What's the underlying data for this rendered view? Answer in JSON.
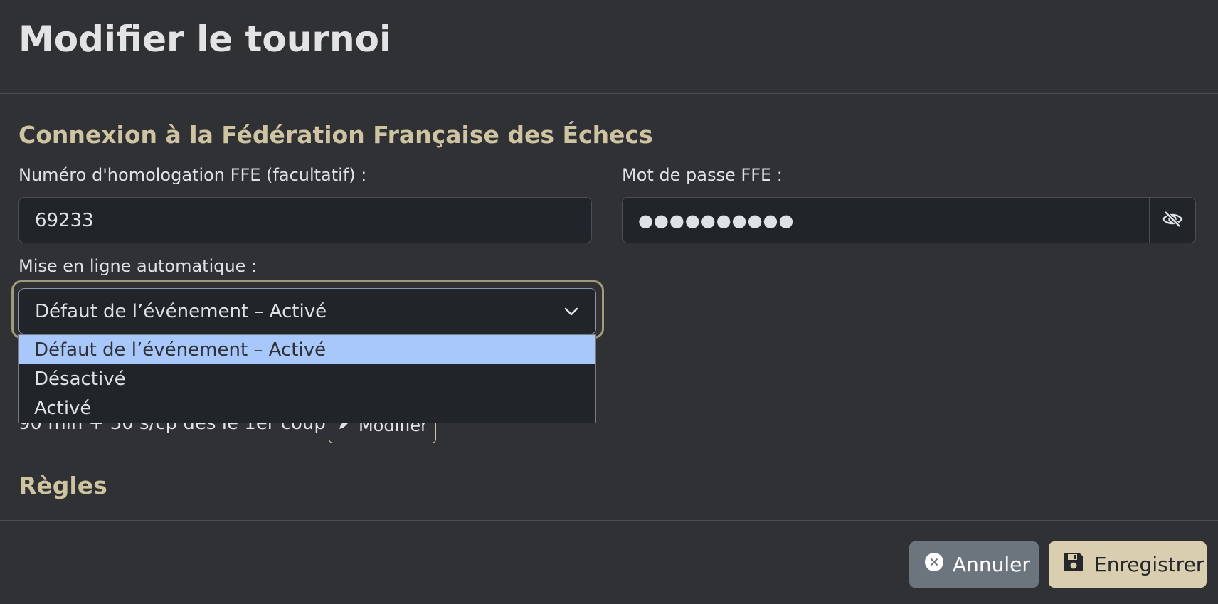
{
  "header": {
    "title": "Modifier le tournoi"
  },
  "ffe_section": {
    "title": "Connexion à la Fédération Française des Échecs",
    "homologation_label": "Numéro d'homologation FFE (facultatif) :",
    "homologation_value": "69233",
    "password_label": "Mot de passe FFE :",
    "password_value": "●●●●●●●●●●",
    "password_toggle_icon": "eye-slash-icon",
    "auto_upload_label": "Mise en ligne automatique :",
    "auto_upload_selected": "Défaut de l’événement – Activé",
    "auto_upload_options": [
      "Défaut de l’événement – Activé",
      "Désactivé",
      "Activé"
    ]
  },
  "cadence": {
    "text": "90 min + 30 s/cp dès le 1er coup",
    "modify_label": "Modifier"
  },
  "rules_section": {
    "title": "Règles"
  },
  "footer": {
    "cancel_label": "Annuler",
    "save_label": "Enregistrer"
  },
  "colors": {
    "background": "#303134",
    "accent": "#cfc4a2",
    "highlight": "#a8c7fa"
  }
}
